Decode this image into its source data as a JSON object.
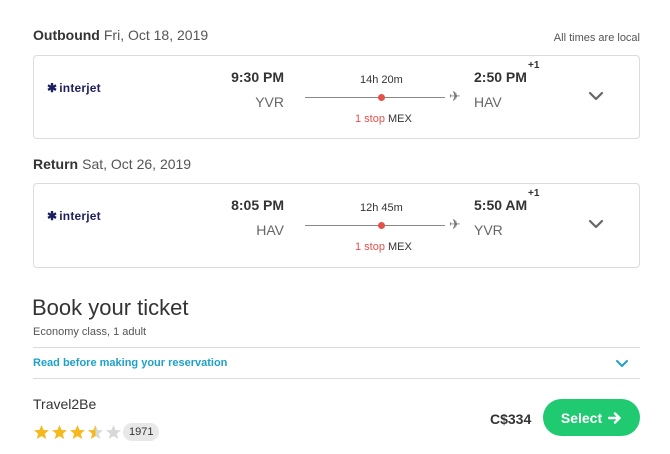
{
  "outbound": {
    "label": "Outbound",
    "date": "Fri, Oct 18, 2019",
    "airline": "interjet",
    "dep_time": "9:30 PM",
    "dep_code": "YVR",
    "duration": "14h 20m",
    "stops": "1 stop",
    "stop_code": "MEX",
    "arr_time": "2:50 PM",
    "day_offset": "+1",
    "arr_code": "HAV"
  },
  "local_note": "All times are local",
  "return": {
    "label": "Return",
    "date": "Sat, Oct 26, 2019",
    "airline": "interjet",
    "dep_time": "8:05 PM",
    "dep_code": "HAV",
    "duration": "12h 45m",
    "stops": "1 stop",
    "stop_code": "MEX",
    "arr_time": "5:50 AM",
    "day_offset": "+1",
    "arr_code": "YVR"
  },
  "booking": {
    "title": "Book your ticket",
    "subtitle": "Economy class, 1 adult",
    "read_link": "Read before making your reservation",
    "provider": "Travel2Be",
    "rating": 3.5,
    "rating_max": 5,
    "review_count": "1971",
    "price": "C$334",
    "select_label": "Select"
  },
  "colors": {
    "accent_green": "#1fca70",
    "link_blue": "#1ea0c8",
    "stop_red": "#e2514a",
    "star_gold": "#f5b91e"
  }
}
